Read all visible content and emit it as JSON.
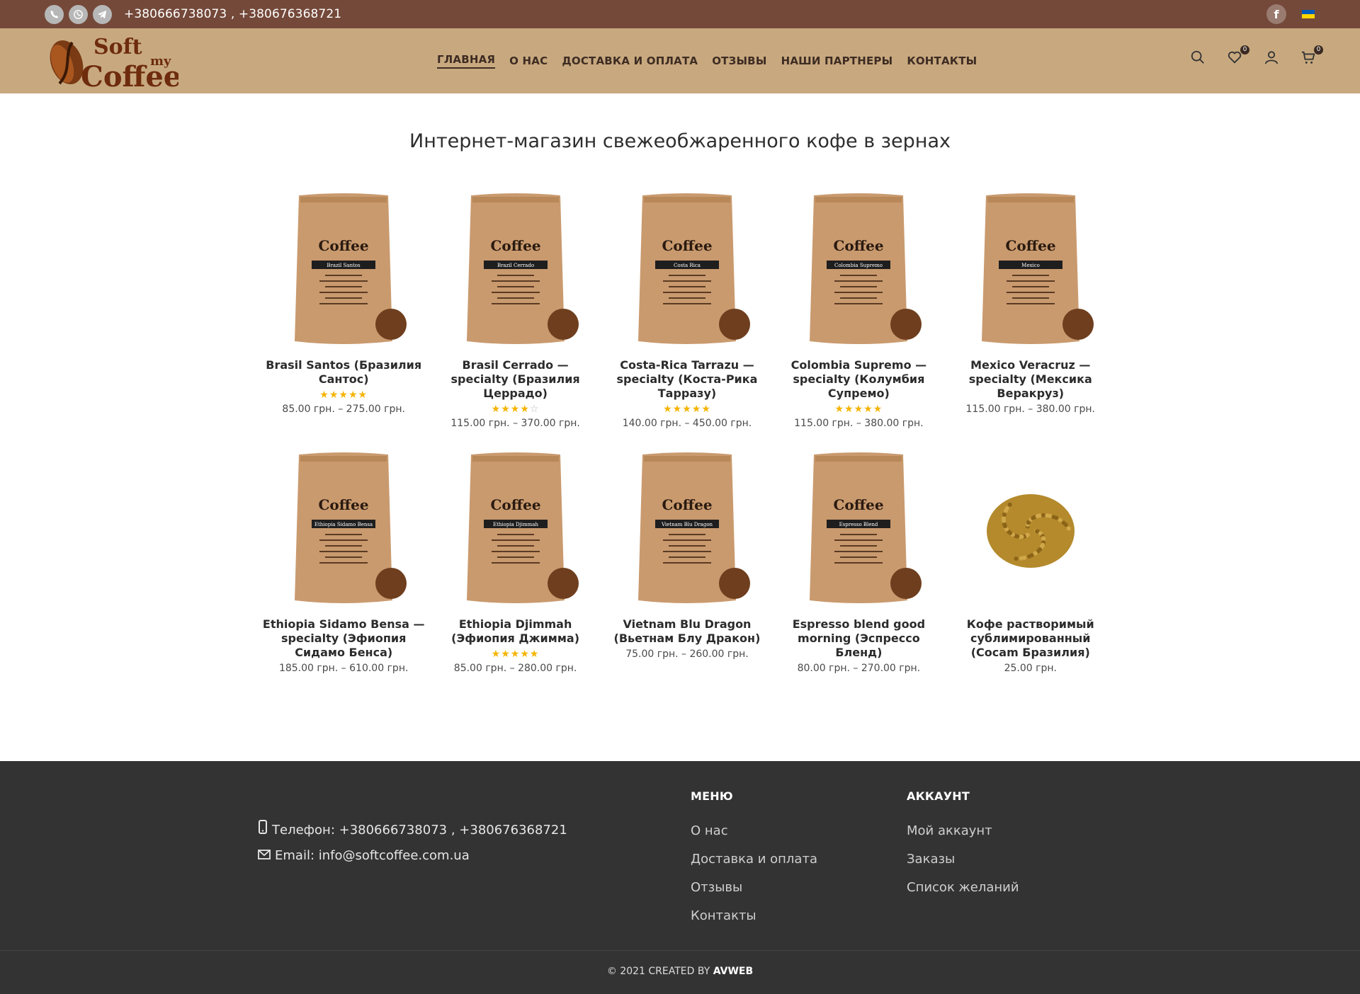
{
  "topbar": {
    "phones": "+380666738073 , +380676368721",
    "messengers": [
      "viber-icon",
      "whatsapp-icon",
      "telegram-icon"
    ],
    "facebook": "f",
    "flag_colors": [
      "#005bbb",
      "#ffd500"
    ]
  },
  "header": {
    "logo_text_soft": "Soft",
    "logo_text_my": "my",
    "logo_text_coffee": "Coffee",
    "nav": [
      "ГЛАВНАЯ",
      "О НАС",
      "ДОСТАВКА И ОПЛАТА",
      "ОТЗЫВЫ",
      "НАШИ ПАРТНЕРЫ",
      "КОНТАКТЫ"
    ],
    "wishlist_count": "0",
    "cart_count": "0"
  },
  "page_title": "Интернет-магазин свежеобжаренного кофе в зернах",
  "products": [
    {
      "name": "Brasil Santos (Бразилия Сантос)",
      "label": "Brazil Santos",
      "rating": 5,
      "price": "85.00 грн. – 275.00 грн."
    },
    {
      "name": "Brasil Cerrado — specialty (Бразилия Церрадо)",
      "label": "Brazil Cerrado",
      "rating": 4,
      "price": "115.00 грн. – 370.00 грн."
    },
    {
      "name": "Costa-Rica Tarrazu — specialty (Коста-Рика Тарразу)",
      "label": "Costa Rica",
      "rating": 5,
      "price": "140.00 грн. – 450.00 грн."
    },
    {
      "name": "Colombia Supremo — specialty (Колумбия Супремо)",
      "label": "Colombia Supremo",
      "rating": 5,
      "price": "115.00 грн. – 380.00 грн."
    },
    {
      "name": "Mexico Veracruz — specialty (Мексика Веракруз)",
      "label": "Mexico",
      "rating": 0,
      "price": "115.00 грн. – 380.00 грн."
    },
    {
      "name": "Ethiopia Sidamo Bensa — specialty (Эфиопия Сидамо Бенса)",
      "label": "Ethiopia Sidamo Bensa",
      "rating": 0,
      "price": "185.00 грн. – 610.00 грн."
    },
    {
      "name": "Ethiopia Djimmah (Эфиопия Джимма)",
      "label": "Ethiopia Djimmah",
      "rating": 5,
      "price": "85.00 грн. – 280.00 грн."
    },
    {
      "name": "Vietnam Blu Dragon (Вьетнам Блу Дракон)",
      "label": "Vietnam Blu Dragon",
      "rating": 0,
      "price": "75.00 грн. – 260.00 грн."
    },
    {
      "name": "Espresso blend good morning (Эспрессо Бленд)",
      "label": "Espresso Blend",
      "rating": 0,
      "price": "80.00 грн. – 270.00 грн."
    },
    {
      "name": "Кофе растворимый сублимированный (Cocam Бразилия)",
      "label": "",
      "rating": 0,
      "price": "25.00 грн."
    }
  ],
  "footer": {
    "phone": "Телефон: +380666738073 , +380676368721",
    "email": "Email: info@softcoffee.com.ua",
    "menu_title": "МЕНЮ",
    "menu": [
      "О нас",
      "Доставка и оплата",
      "Отзывы",
      "Контакты"
    ],
    "account_title": "АККАУНТ",
    "account": [
      "Мой аккаунт",
      "Заказы",
      "Список желаний"
    ],
    "copyright_pre": "2021 CREATED BY",
    "copyright_brand": "AVWEB"
  },
  "colors": {
    "topbar": "#74493a",
    "header": "#c8a97f",
    "footer": "#333333",
    "star": "#f5b400",
    "bag": "#c99a6e"
  }
}
